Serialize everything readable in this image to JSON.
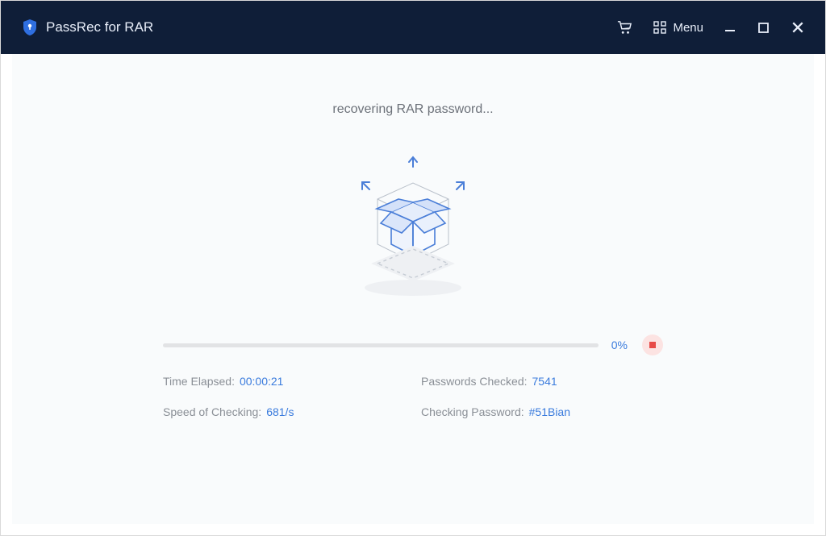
{
  "app": {
    "title": "PassRec for RAR",
    "menu_label": "Menu"
  },
  "status": {
    "heading": "recovering RAR password..."
  },
  "progress": {
    "percent_text": "0%",
    "percent_value": 0
  },
  "stats": {
    "time_elapsed_label": "Time Elapsed:",
    "time_elapsed_value": "00:00:21",
    "passwords_checked_label": "Passwords Checked:",
    "passwords_checked_value": "7541",
    "speed_label": "Speed of Checking:",
    "speed_value": "681/s",
    "checking_password_label": "Checking Password:",
    "checking_password_value": "#51Bian"
  },
  "colors": {
    "accent": "#3a7bdd",
    "titlebar": "#0f1e38",
    "stop_bg": "#fce3e2",
    "stop_fg": "#e74a47"
  }
}
